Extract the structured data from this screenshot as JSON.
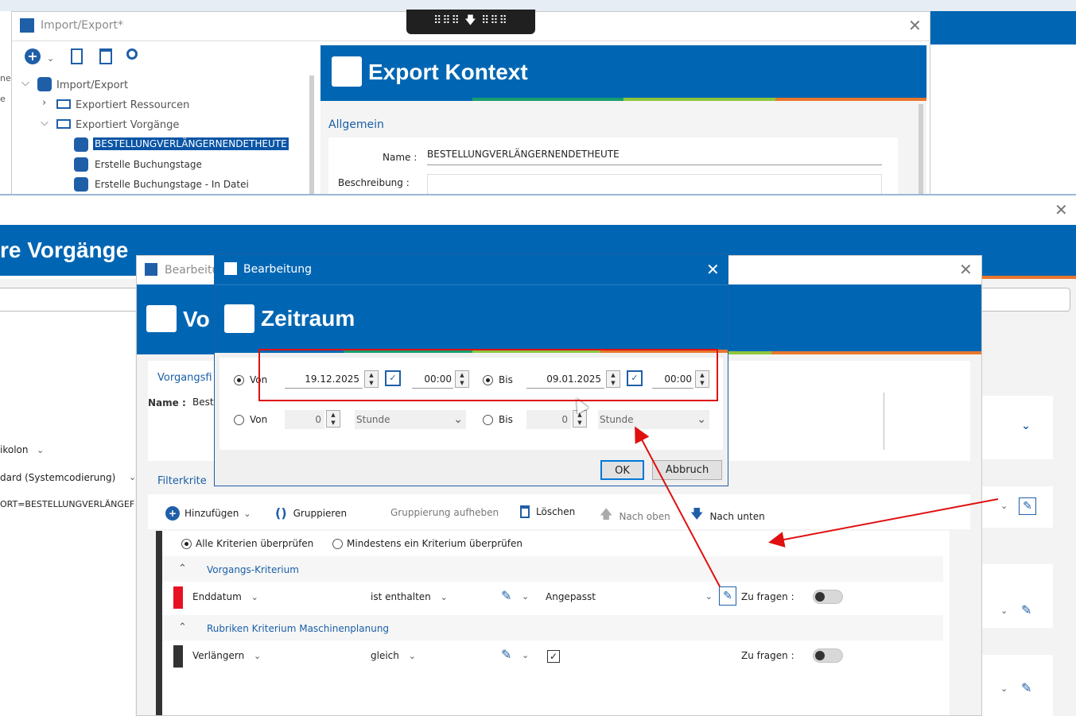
{
  "import_window": {
    "title": "Import/Export*",
    "tree": {
      "root": "Import/Export",
      "items": [
        "Exportiert Ressourcen",
        "Exportiert Vorgänge"
      ],
      "children": [
        "BESTELLUNGVERLÄNGERNENDETHEUTE",
        "Erstelle Buchungstage",
        "Erstelle Buchungstage - In Datei"
      ]
    },
    "left_edge": [
      "ne",
      "e"
    ]
  },
  "export_panel": {
    "title": "Export Kontext",
    "section": "Allgemein",
    "name_label": "Name :",
    "name_value": "BESTELLUNGVERLÄNGERNENDETHEUTE",
    "desc_label": "Beschreibung :"
  },
  "vorgaenge_window": {
    "title_partial": "re Vorgänge",
    "left_items": [
      "ikolon",
      "dard (Systemcodierung)",
      "ORT=BESTELLUNGVERLÄNGEF"
    ]
  },
  "bearbeitung_back": {
    "title_partial": "Bearbeitu",
    "header_partial": "Vo",
    "section_partial": "Vorgangsfi",
    "name_label": "Name :",
    "name_value_partial": "Best",
    "filter_partial": "Filterkrite",
    "toolbar": {
      "add": "Hinzufügen",
      "group": "Gruppieren",
      "ungroup": "Gruppierung aufheben",
      "delete": "Löschen",
      "up": "Nach oben",
      "down": "Nach unten"
    },
    "criteria_mode": {
      "all": "Alle Kriterien überprüfen",
      "any": "Mindestens ein Kriterium überprüfen"
    },
    "groups": [
      {
        "title": "Vorgangs-Kriterium",
        "field": "Enddatum",
        "operator": "ist enthalten",
        "value": "Angepasst",
        "ask_label": "Zu fragen :",
        "color": "#e81123"
      },
      {
        "title": "Rubriken Kriterium Maschinenplanung",
        "field": "Verlängern",
        "operator": "gleich",
        "value": "",
        "ask_label": "Zu fragen :",
        "color": "#333333"
      }
    ]
  },
  "zeitraum_dialog": {
    "title": "Bearbeitung",
    "header": "Zeitraum",
    "row1": {
      "from_label": "Von",
      "from_date": "19.12.2025",
      "from_time": "00:00",
      "to_label": "Bis",
      "to_date": "09.01.2025",
      "to_time": "00:00"
    },
    "row2": {
      "from_label": "Von",
      "from_num": "0",
      "from_unit": "Stunde",
      "to_label": "Bis",
      "to_num": "0",
      "to_unit": "Stunde"
    },
    "ok": "OK",
    "cancel": "Abbruch"
  },
  "colors": {
    "brand_blue": "#0066b3",
    "stripe": [
      "#1a9e6e",
      "#5cb85c",
      "#f0ad4e",
      "#e8772e"
    ],
    "annotation_red": "#e01010"
  }
}
